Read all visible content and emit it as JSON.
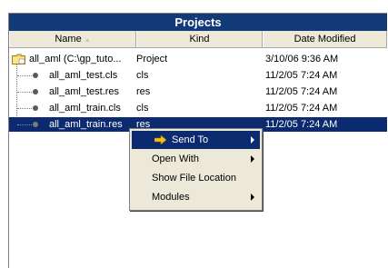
{
  "panel": {
    "title": "Projects"
  },
  "columns": {
    "name": "Name",
    "kind": "Kind",
    "date": "Date Modified"
  },
  "rows": [
    {
      "name": "all_aml (C:\\gp_tuto...",
      "kind": "Project",
      "date": "3/10/06 9:36 AM",
      "icon": "folder-icon"
    },
    {
      "name": "all_aml_test.cls",
      "kind": "cls",
      "date": "11/2/05 7:24 AM",
      "icon": "file-dot-icon"
    },
    {
      "name": "all_aml_test.res",
      "kind": "res",
      "date": "11/2/05 7:24 AM",
      "icon": "file-dot-icon"
    },
    {
      "name": "all_aml_train.cls",
      "kind": "cls",
      "date": "11/2/05 7:24 AM",
      "icon": "file-dot-icon"
    },
    {
      "name": "all_aml_train.res",
      "kind": "res",
      "date": "11/2/05 7:24 AM",
      "icon": "file-dot-icon",
      "selected": true
    }
  ],
  "context_menu": {
    "items": [
      {
        "label": "Send To",
        "submenu": true,
        "icon": "arrow-right-icon",
        "active": true
      },
      {
        "label": "Open With",
        "submenu": true
      },
      {
        "label": "Show File Location",
        "submenu": false
      },
      {
        "label": "Modules",
        "submenu": true
      }
    ]
  },
  "colors": {
    "title_bg": "#123a78",
    "selection_bg": "#0b2a6f",
    "menu_bg": "#ece9d8",
    "send_to_arrow": "#f0c020"
  }
}
